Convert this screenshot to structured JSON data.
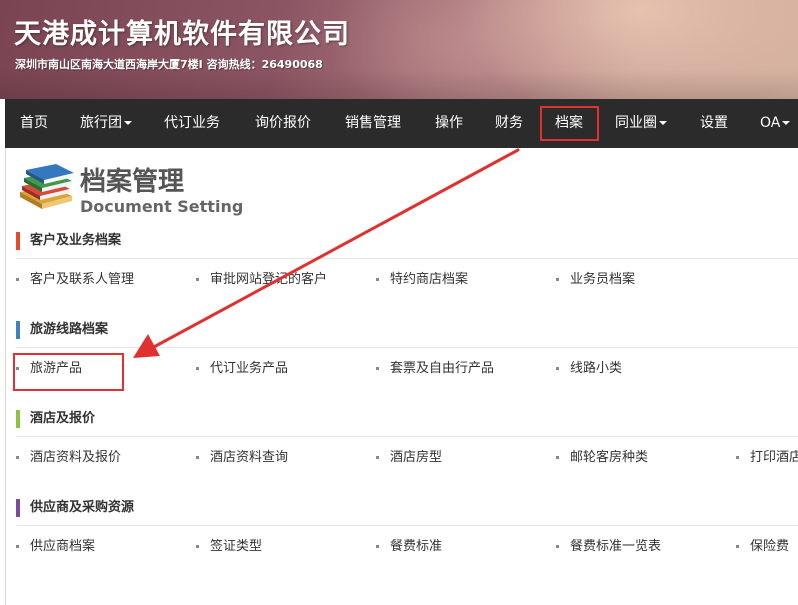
{
  "banner": {
    "company_name": "天港成计算机软件有限公司",
    "address_line": "深圳市南山区南海大道西海岸大厦7楼I  咨询热线：26490068"
  },
  "nav": {
    "items": [
      {
        "label": "首页"
      },
      {
        "label": "旅行团"
      },
      {
        "label": "代订业务"
      },
      {
        "label": "询价报价"
      },
      {
        "label": "销售管理"
      },
      {
        "label": "操作"
      },
      {
        "label": "财务"
      },
      {
        "label": "档案"
      },
      {
        "label": "同业圈"
      },
      {
        "label": "设置"
      },
      {
        "label": "OA"
      }
    ]
  },
  "page": {
    "title": "档案管理",
    "subtitle": "Document Setting"
  },
  "sections": [
    {
      "title": "客户及业务档案",
      "color": "#e8492d",
      "items": [
        {
          "label": "客户及联系人管理"
        },
        {
          "label": "审批网站登记的客户"
        },
        {
          "label": "特约商店档案"
        },
        {
          "label": "业务员档案"
        }
      ]
    },
    {
      "title": "旅游线路档案",
      "color": "#3f7fc4",
      "items": [
        {
          "label": "旅游产品"
        },
        {
          "label": "代订业务产品"
        },
        {
          "label": "套票及自由行产品"
        },
        {
          "label": "线路小类"
        }
      ]
    },
    {
      "title": "酒店及报价",
      "color": "#8bc53f",
      "items": [
        {
          "label": "酒店资料及报价"
        },
        {
          "label": "酒店资料查询"
        },
        {
          "label": "酒店房型"
        },
        {
          "label": "邮轮客房种类"
        },
        {
          "label": "打印酒店"
        }
      ]
    },
    {
      "title": "供应商及采购资源",
      "color": "#7b4c9e",
      "items": [
        {
          "label": "供应商档案"
        },
        {
          "label": "签证类型"
        },
        {
          "label": "餐费标准"
        },
        {
          "label": "餐费标准一览表"
        },
        {
          "label": "保险费"
        }
      ]
    }
  ],
  "annotation": {
    "highlight_color": "#e03030"
  }
}
